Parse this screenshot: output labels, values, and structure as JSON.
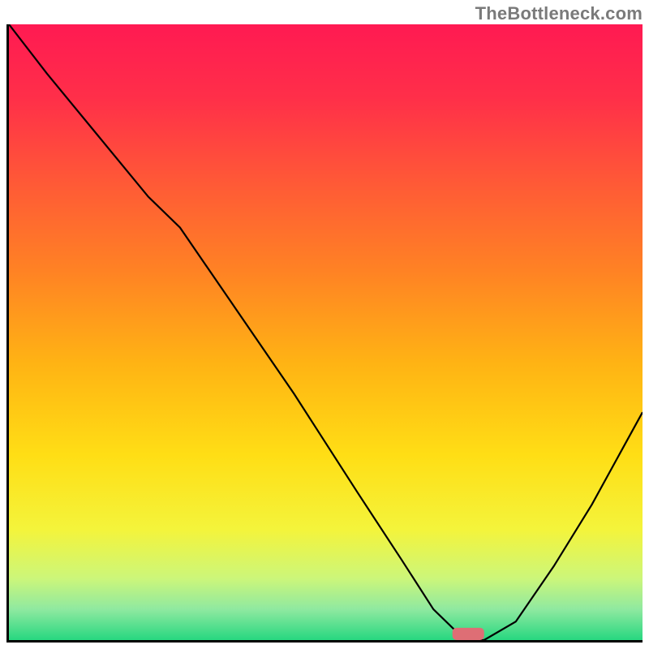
{
  "watermark": "TheBottleneck.com",
  "chart_data": {
    "type": "line",
    "title": "",
    "xlabel": "",
    "ylabel": "",
    "xlim": [
      0,
      100
    ],
    "ylim": [
      0,
      100
    ],
    "grid": false,
    "background_gradient": {
      "stops": [
        {
          "offset": 0.0,
          "color": "#ff1a52"
        },
        {
          "offset": 0.12,
          "color": "#ff2f49"
        },
        {
          "offset": 0.26,
          "color": "#ff5a36"
        },
        {
          "offset": 0.4,
          "color": "#ff8224"
        },
        {
          "offset": 0.55,
          "color": "#ffb314"
        },
        {
          "offset": 0.7,
          "color": "#ffde15"
        },
        {
          "offset": 0.82,
          "color": "#f4f43b"
        },
        {
          "offset": 0.9,
          "color": "#ccf67a"
        },
        {
          "offset": 0.95,
          "color": "#8fe9a0"
        },
        {
          "offset": 1.0,
          "color": "#27d780"
        }
      ]
    },
    "series": [
      {
        "name": "curve",
        "x": [
          0,
          6,
          14,
          22,
          27,
          35,
          45,
          55,
          62,
          67,
          70,
          72,
          75,
          80,
          86,
          92,
          100
        ],
        "y": [
          100,
          92,
          82,
          72,
          67,
          55,
          40,
          24,
          13,
          5,
          2,
          0,
          0,
          3,
          12,
          22,
          37
        ]
      }
    ],
    "marker": {
      "shape": "rounded-rect",
      "x": 72.5,
      "y": 0,
      "width": 5,
      "height": 2,
      "color": "#de6e75"
    }
  }
}
